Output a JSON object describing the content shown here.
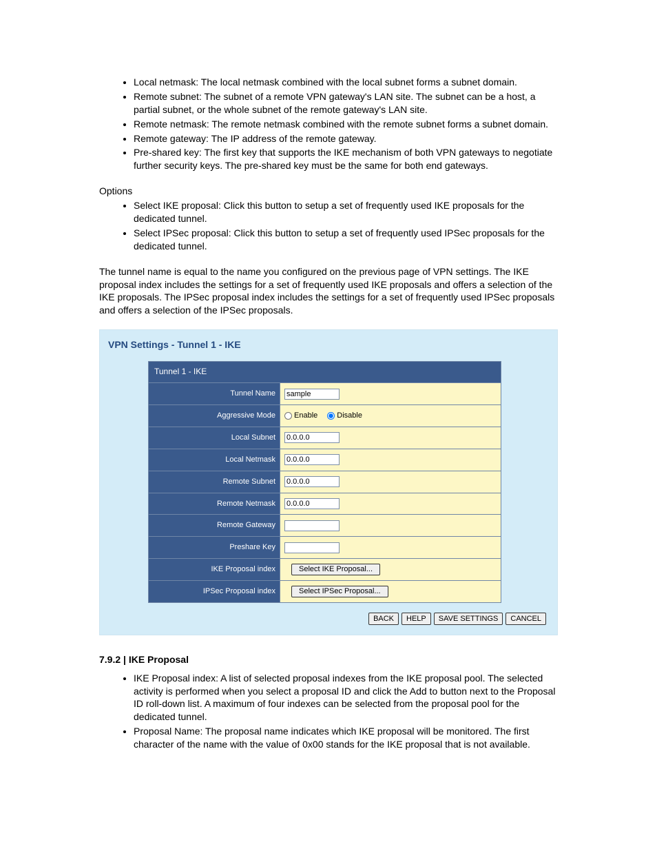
{
  "bullets1": [
    "Local netmask: The local netmask combined with the local subnet forms a subnet domain.",
    "Remote subnet: The subnet of a remote VPN gateway's LAN site. The subnet can be a host, a partial subnet, or the whole subnet of the remote gateway's LAN site.",
    "Remote netmask: The remote netmask combined with the remote subnet forms a subnet domain.",
    "Remote gateway: The IP address of the remote gateway.",
    "Pre-shared key: The first key that supports the IKE mechanism of both VPN gateways to negotiate further security keys. The pre-shared key must be the same for both end gateways."
  ],
  "options_label": "Options",
  "options_bullets": [
    "Select IKE proposal: Click this button to setup a set of frequently used IKE proposals for the dedicated tunnel.",
    "Select IPSec proposal: Click this button to setup a set of frequently used IPSec proposals for the dedicated tunnel."
  ],
  "paragraph": "The tunnel name is equal to the name you configured on the previous page of VPN settings. The IKE proposal index includes the settings for a set of frequently used IKE proposals and offers a selection of the IKE proposals. The IPSec proposal index includes the settings for a set of frequently used IPSec proposals and offers a selection of the IPSec proposals.",
  "panel": {
    "title": "VPN Settings - Tunnel 1 - IKE",
    "table_header": "Tunnel 1 - IKE",
    "rows": {
      "tunnel_name": {
        "label": "Tunnel Name",
        "value": "sample"
      },
      "aggressive_mode": {
        "label": "Aggressive Mode",
        "enable": "Enable",
        "disable": "Disable",
        "selected": "disable"
      },
      "local_subnet": {
        "label": "Local Subnet",
        "value": "0.0.0.0"
      },
      "local_netmask": {
        "label": "Local Netmask",
        "value": "0.0.0.0"
      },
      "remote_subnet": {
        "label": "Remote Subnet",
        "value": "0.0.0.0"
      },
      "remote_netmask": {
        "label": "Remote Netmask",
        "value": "0.0.0.0"
      },
      "remote_gateway": {
        "label": "Remote Gateway",
        "value": ""
      },
      "preshare_key": {
        "label": "Preshare Key",
        "value": ""
      },
      "ike_index": {
        "label": "IKE Proposal index",
        "button": "Select IKE Proposal..."
      },
      "ipsec_index": {
        "label": "IPSec Proposal index",
        "button": "Select IPSec Proposal..."
      }
    },
    "footer": {
      "back": "BACK",
      "help": "HELP",
      "save": "SAVE SETTINGS",
      "cancel": "CANCEL"
    }
  },
  "section2": {
    "heading": "7.9.2 | IKE Proposal",
    "bullets": [
      "IKE Proposal index: A list of selected proposal indexes from the IKE proposal pool. The selected activity is performed when you select a proposal ID and click the Add to button next to the Proposal ID roll-down list. A maximum of four indexes can be selected from the proposal pool for the dedicated tunnel.",
      "Proposal Name: The proposal name indicates which IKE proposal will be monitored. The first character of the name with the value of 0x00 stands for the IKE proposal that is not available."
    ]
  }
}
